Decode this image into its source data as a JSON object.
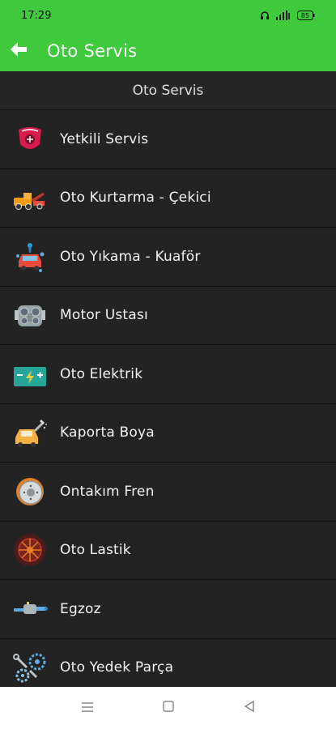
{
  "status_bar": {
    "time": "17:29",
    "battery": "85"
  },
  "app_bar": {
    "title": "Oto Servis"
  },
  "list": {
    "header": "Oto Servis",
    "items": [
      {
        "label": "Yetkili Servis",
        "icon": "brand-emblem-icon"
      },
      {
        "label": "Oto Kurtarma - Çekici",
        "icon": "tow-truck-icon"
      },
      {
        "label": "Oto Yıkama - Kuaför",
        "icon": "car-wash-icon"
      },
      {
        "label": "Motor Ustası",
        "icon": "engine-icon"
      },
      {
        "label": "Oto Elektrik",
        "icon": "car-battery-icon"
      },
      {
        "label": "Kaporta Boya",
        "icon": "car-paint-icon"
      },
      {
        "label": "Ontakım Fren",
        "icon": "brake-disc-icon"
      },
      {
        "label": "Oto Lastik",
        "icon": "tire-icon"
      },
      {
        "label": "Egzoz",
        "icon": "exhaust-icon"
      },
      {
        "label": "Oto Yedek Parça",
        "icon": "spare-parts-icon"
      }
    ]
  },
  "colors": {
    "accent": "#3fc93c",
    "background": "#222222",
    "divider": "#111111"
  }
}
